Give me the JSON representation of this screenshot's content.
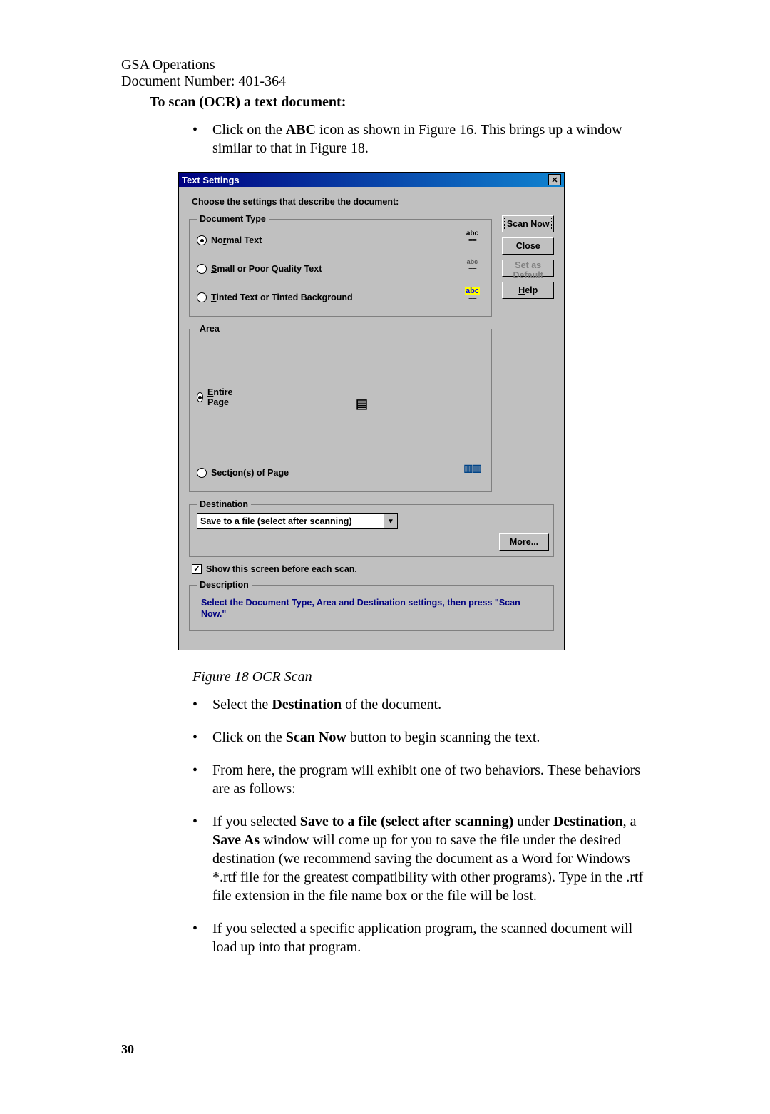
{
  "header": {
    "line1": "GSA Operations",
    "line2": "Document Number: 401-364"
  },
  "section_title": "To scan (OCR) a text document:",
  "intro_bullet_pre": "Click on the ",
  "intro_bullet_bold": "ABC",
  "intro_bullet_post": " icon as shown in Figure 16. This brings up a window similar to that in Figure 18.",
  "dialog": {
    "title": "Text Settings",
    "prompt": "Choose the settings that describe the document:",
    "groups": {
      "doctype": {
        "legend": "Document Type",
        "opts": {
          "normal": "Normal Text",
          "small": "Small or Poor Quality Text",
          "tinted": "Tinted Text or Tinted Background"
        }
      },
      "area": {
        "legend": "Area",
        "opts": {
          "entire": "Entire Page",
          "sections": "Section(s) of Page"
        }
      },
      "dest": {
        "legend": "Destination",
        "value": "Save to a file (select after scanning)"
      },
      "desc": {
        "legend": "Description",
        "text": "Select the Document Type, Area and Destination settings, then press \"Scan Now.\""
      }
    },
    "buttons": {
      "scan": "Scan Now",
      "close": "Close",
      "default": "Set as Default",
      "help": "Help",
      "more": "More..."
    },
    "checkbox": "Show this screen before each scan."
  },
  "figure_caption": "Figure 18 OCR Scan",
  "bullets_after": [
    {
      "pre": "Select the ",
      "b1": "Destination",
      "post": " of the document."
    },
    {
      "pre": "Click on the ",
      "b1": "Scan Now",
      "post": " button to begin scanning the text."
    },
    {
      "pre": "From here, the program will exhibit one of two behaviors. These behaviors are as follows:"
    },
    {
      "pre": "If you selected ",
      "b1": "Save to a file (select after scanning)",
      "mid1": " under ",
      "b2": "Destination",
      "mid2": ", a ",
      "b3": "Save As",
      "post": " window will come up for you to save the file under the desired destination (we recommend saving the document as a Word for Windows *.rtf file for the greatest compatibility with other programs). Type in the .rtf file extension in the file name box or the file will be lost."
    },
    {
      "pre": "If you selected a specific application program, the scanned document will load up into that program."
    }
  ],
  "page_number": "30"
}
